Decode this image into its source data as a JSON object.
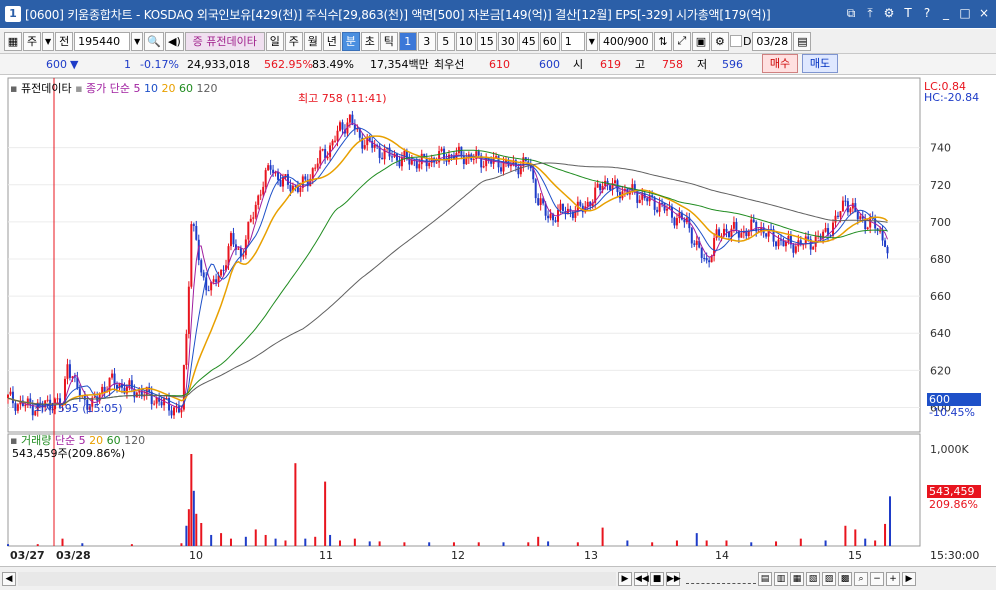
{
  "window": {
    "badge": "1",
    "title": "[0600] 키움종합차트 - KOSDAQ 외국인보유[429(천)] 주식수[29,863(천)] 액면[500] 자본금[149(억)] 결산[12월] EPS[-329] 시가총액[179(억)]"
  },
  "toolbar": {
    "period_main": "주",
    "prev_label": "전",
    "code": "195440",
    "indicator_tab": "증 퓨전데이타",
    "periods": [
      "일",
      "주",
      "월",
      "년"
    ],
    "minute_label": "분",
    "second_label": "초",
    "tick_label": "틱",
    "intervals": [
      "1",
      "3",
      "5",
      "10",
      "15",
      "30",
      "45",
      "60"
    ],
    "multiplier": "1",
    "count": "400/900",
    "date_check_label": "D",
    "date": "03/28"
  },
  "infobar": {
    "price": "600",
    "change": "1",
    "change_pct": "-0.17%",
    "volume": "24,933,018",
    "volume_ratio": "562.95%",
    "ratio2": "83.49%",
    "amount": "17,354백만",
    "best_bid_label": "최우선",
    "best_bid": "610",
    "best_ask": "600",
    "open_label": "시",
    "open": "619",
    "high_label": "고",
    "high": "758",
    "low_label": "저",
    "low": "596",
    "buy_label": "매수",
    "sell_label": "매도"
  },
  "legend": {
    "name": "퓨전데이타",
    "ma_label": "종가 단순",
    "ma_periods": [
      "5",
      "10",
      "20",
      "60",
      "120"
    ],
    "lc": "LC:0.84",
    "hc": "HC:-20.84",
    "high_annotation": "최고 758 (11:41)",
    "low_annotation": "최저 595 (15:05)",
    "current_price_tag": "600",
    "current_pct_tag": "-10.45%",
    "volume_label": "거래량",
    "volume_ma_label": "단순",
    "volume_ma_periods": [
      "5",
      "20",
      "60",
      "120"
    ],
    "volume_value": "543,459주(209.86%)",
    "volume_tag": "543,459",
    "volume_pct_tag": "209.86%",
    "volume_axis_top": "1,000K"
  },
  "colors": {
    "up": "#e8141e",
    "down": "#1e3cc8",
    "ma5": "#a020a0",
    "ma10": "#1e50c8",
    "ma20": "#e8a000",
    "ma60": "#208c20",
    "ma120": "#606060",
    "title_bg": "#2b5fa8"
  },
  "chart_data": {
    "type": "candlestick",
    "y_ticks": [
      600,
      620,
      640,
      660,
      680,
      700,
      720,
      740
    ],
    "ylim": [
      590,
      770
    ],
    "x_labels": [
      "03/27",
      "03/28",
      "10",
      "11",
      "12",
      "13",
      "14",
      "15"
    ],
    "time_label": "15:30:00",
    "close_path": [
      [
        0,
        605
      ],
      [
        4,
        602
      ],
      [
        8,
        601
      ],
      [
        12,
        600
      ],
      [
        18,
        603
      ],
      [
        22,
        601
      ],
      [
        24,
        625
      ],
      [
        27,
        612
      ],
      [
        30,
        605
      ],
      [
        34,
        601
      ],
      [
        38,
        610
      ],
      [
        42,
        614
      ],
      [
        48,
        610
      ],
      [
        54,
        608
      ],
      [
        60,
        604
      ],
      [
        66,
        600
      ],
      [
        70,
        598
      ],
      [
        72,
        640
      ],
      [
        74,
        700
      ],
      [
        76,
        690
      ],
      [
        78,
        670
      ],
      [
        82,
        665
      ],
      [
        86,
        672
      ],
      [
        90,
        690
      ],
      [
        94,
        682
      ],
      [
        98,
        700
      ],
      [
        102,
        718
      ],
      [
        106,
        730
      ],
      [
        110,
        722
      ],
      [
        114,
        720
      ],
      [
        118,
        718
      ],
      [
        122,
        725
      ],
      [
        126,
        735
      ],
      [
        130,
        740
      ],
      [
        134,
        750
      ],
      [
        138,
        755
      ],
      [
        142,
        745
      ],
      [
        146,
        742
      ],
      [
        150,
        738
      ],
      [
        156,
        735
      ],
      [
        162,
        733
      ],
      [
        168,
        732
      ],
      [
        174,
        735
      ],
      [
        180,
        736
      ],
      [
        186,
        735
      ],
      [
        192,
        733
      ],
      [
        198,
        732
      ],
      [
        204,
        730
      ],
      [
        210,
        732
      ],
      [
        214,
        712
      ],
      [
        218,
        702
      ],
      [
        224,
        706
      ],
      [
        230,
        706
      ],
      [
        236,
        712
      ],
      [
        240,
        722
      ],
      [
        246,
        717
      ],
      [
        252,
        716
      ],
      [
        258,
        712
      ],
      [
        264,
        708
      ],
      [
        270,
        702
      ],
      [
        274,
        700
      ],
      [
        278,
        686
      ],
      [
        282,
        678
      ],
      [
        286,
        692
      ],
      [
        290,
        696
      ],
      [
        296,
        694
      ],
      [
        302,
        698
      ],
      [
        308,
        692
      ],
      [
        314,
        688
      ],
      [
        320,
        688
      ],
      [
        326,
        690
      ],
      [
        330,
        694
      ],
      [
        334,
        700
      ],
      [
        338,
        712
      ],
      [
        342,
        704
      ],
      [
        346,
        700
      ],
      [
        350,
        698
      ],
      [
        354,
        690
      ],
      [
        356,
        672
      ]
    ],
    "volume_bars": [
      [
        0,
        2
      ],
      [
        12,
        2
      ],
      [
        22,
        8
      ],
      [
        30,
        3
      ],
      [
        50,
        2
      ],
      [
        70,
        3
      ],
      [
        72,
        22
      ],
      [
        73,
        40
      ],
      [
        74,
        100
      ],
      [
        75,
        60
      ],
      [
        76,
        35
      ],
      [
        78,
        25
      ],
      [
        82,
        12
      ],
      [
        86,
        14
      ],
      [
        90,
        8
      ],
      [
        96,
        10
      ],
      [
        100,
        18
      ],
      [
        104,
        12
      ],
      [
        108,
        8
      ],
      [
        112,
        6
      ],
      [
        116,
        90
      ],
      [
        120,
        8
      ],
      [
        124,
        10
      ],
      [
        128,
        70
      ],
      [
        130,
        12
      ],
      [
        134,
        6
      ],
      [
        140,
        8
      ],
      [
        146,
        5
      ],
      [
        150,
        5
      ],
      [
        160,
        4
      ],
      [
        170,
        4
      ],
      [
        180,
        4
      ],
      [
        190,
        4
      ],
      [
        200,
        4
      ],
      [
        210,
        4
      ],
      [
        214,
        10
      ],
      [
        218,
        5
      ],
      [
        230,
        4
      ],
      [
        240,
        20
      ],
      [
        250,
        6
      ],
      [
        260,
        4
      ],
      [
        270,
        6
      ],
      [
        278,
        14
      ],
      [
        282,
        6
      ],
      [
        290,
        6
      ],
      [
        300,
        4
      ],
      [
        310,
        5
      ],
      [
        320,
        8
      ],
      [
        330,
        6
      ],
      [
        338,
        22
      ],
      [
        342,
        18
      ],
      [
        346,
        8
      ],
      [
        350,
        6
      ],
      [
        354,
        24
      ],
      [
        356,
        54
      ]
    ]
  }
}
